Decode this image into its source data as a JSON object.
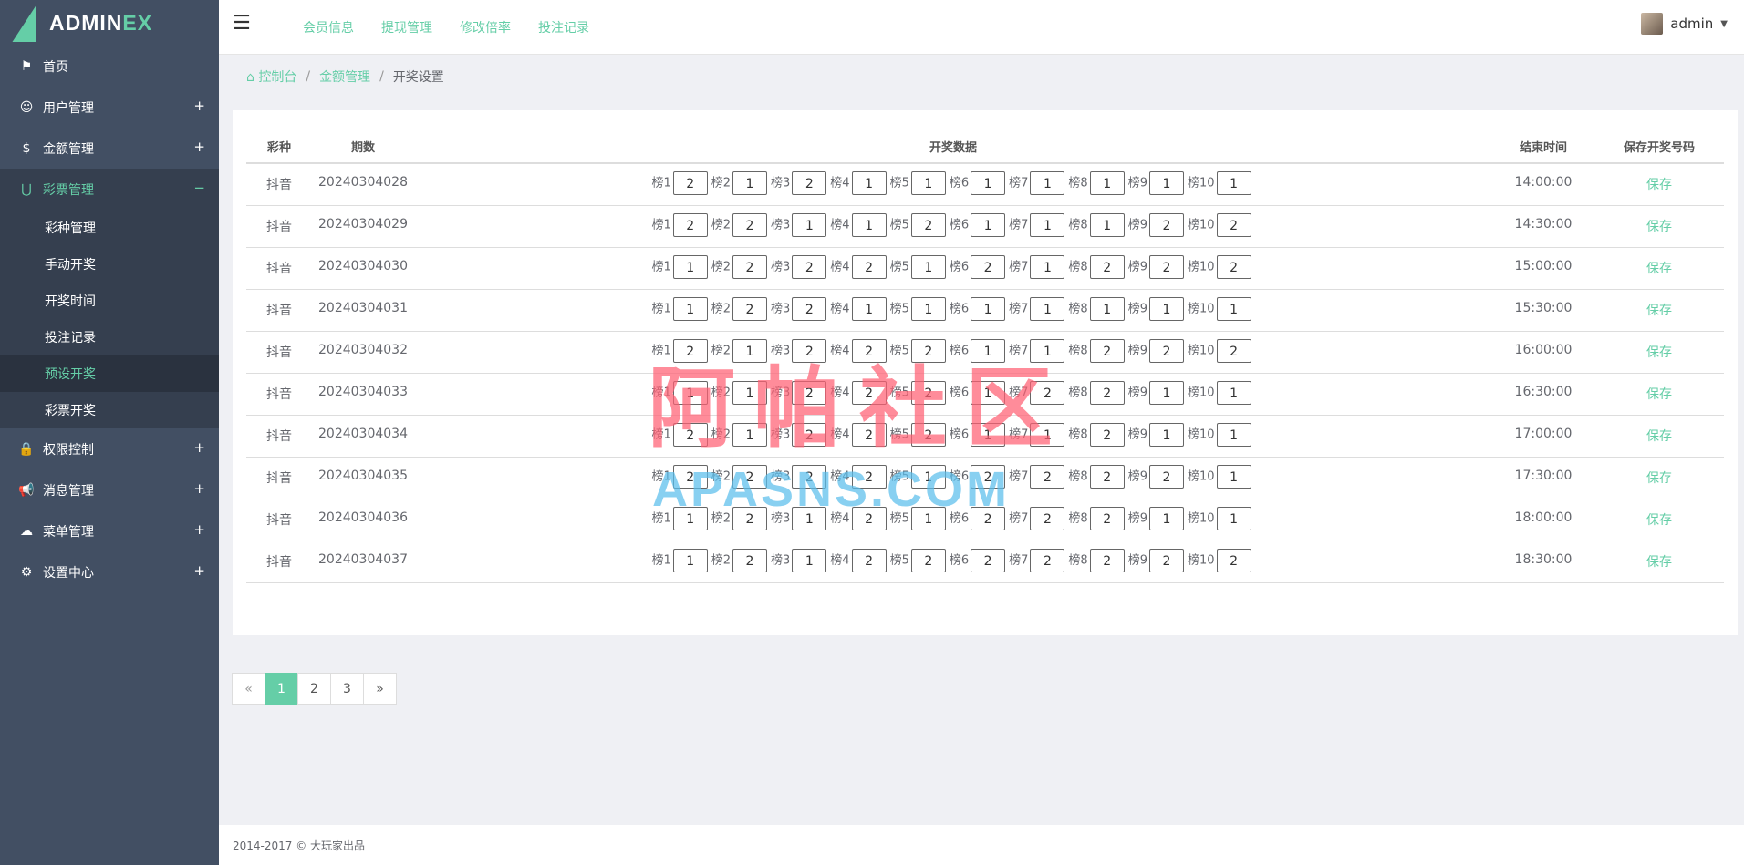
{
  "brand": {
    "name_main": "ADMIN",
    "name_accent": "EX"
  },
  "colors": {
    "accent": "#65cea7",
    "sidebar": "#424f63",
    "sidebar_active": "#353f4f"
  },
  "sidebar": {
    "items": [
      {
        "label": "首页",
        "icon": "flag-icon",
        "toggle": ""
      },
      {
        "label": "用户管理",
        "icon": "user-face-icon",
        "toggle": "+"
      },
      {
        "label": "金额管理",
        "icon": "dollar-icon",
        "toggle": "+"
      },
      {
        "label": "彩票管理",
        "icon": "magnet-icon",
        "toggle": "−",
        "children": [
          "彩种管理",
          "手动开奖",
          "开奖时间",
          "投注记录",
          "预设开奖",
          "彩票开奖"
        ],
        "active_child": "预设开奖"
      },
      {
        "label": "权限控制",
        "icon": "lock-icon",
        "toggle": "+"
      },
      {
        "label": "消息管理",
        "icon": "bullhorn-icon",
        "toggle": "+"
      },
      {
        "label": "菜单管理",
        "icon": "cloud-icon",
        "toggle": "+"
      },
      {
        "label": "设置中心",
        "icon": "gear-icon",
        "toggle": "+"
      }
    ]
  },
  "header": {
    "nav": [
      "会员信息",
      "提现管理",
      "修改倍率",
      "投注记录"
    ],
    "user": "admin"
  },
  "breadcrumb": {
    "home": "控制台",
    "parent": "金额管理",
    "current": "开奖设置"
  },
  "table": {
    "headers": [
      "彩种",
      "期数",
      "开奖数据",
      "结束时间",
      "保存开奖号码"
    ],
    "slot_labels": [
      "榜1",
      "榜2",
      "榜3",
      "榜4",
      "榜5",
      "榜6",
      "榜7",
      "榜8",
      "榜9",
      "榜10"
    ],
    "save_label": "保存",
    "rows": [
      {
        "type": "抖音",
        "period": "20240304028",
        "values": [
          "2",
          "1",
          "2",
          "1",
          "1",
          "1",
          "1",
          "1",
          "1",
          "1"
        ],
        "end": "14:00:00"
      },
      {
        "type": "抖音",
        "period": "20240304029",
        "values": [
          "2",
          "2",
          "1",
          "1",
          "2",
          "1",
          "1",
          "1",
          "2",
          "2"
        ],
        "end": "14:30:00"
      },
      {
        "type": "抖音",
        "period": "20240304030",
        "values": [
          "1",
          "2",
          "2",
          "2",
          "1",
          "2",
          "1",
          "2",
          "2",
          "2"
        ],
        "end": "15:00:00"
      },
      {
        "type": "抖音",
        "period": "20240304031",
        "values": [
          "1",
          "2",
          "2",
          "1",
          "1",
          "1",
          "1",
          "1",
          "1",
          "1"
        ],
        "end": "15:30:00"
      },
      {
        "type": "抖音",
        "period": "20240304032",
        "values": [
          "2",
          "1",
          "2",
          "2",
          "2",
          "1",
          "1",
          "2",
          "2",
          "2"
        ],
        "end": "16:00:00"
      },
      {
        "type": "抖音",
        "period": "20240304033",
        "values": [
          "1",
          "1",
          "2",
          "2",
          "2",
          "1",
          "2",
          "2",
          "1",
          "1"
        ],
        "end": "16:30:00"
      },
      {
        "type": "抖音",
        "period": "20240304034",
        "values": [
          "2",
          "1",
          "2",
          "2",
          "2",
          "1",
          "1",
          "2",
          "1",
          "1"
        ],
        "end": "17:00:00"
      },
      {
        "type": "抖音",
        "period": "20240304035",
        "values": [
          "2",
          "2",
          "2",
          "2",
          "1",
          "2",
          "2",
          "2",
          "2",
          "1"
        ],
        "end": "17:30:00"
      },
      {
        "type": "抖音",
        "period": "20240304036",
        "values": [
          "1",
          "2",
          "1",
          "2",
          "1",
          "2",
          "2",
          "2",
          "1",
          "1"
        ],
        "end": "18:00:00"
      },
      {
        "type": "抖音",
        "period": "20240304037",
        "values": [
          "1",
          "2",
          "1",
          "2",
          "2",
          "2",
          "2",
          "2",
          "2",
          "2"
        ],
        "end": "18:30:00"
      }
    ]
  },
  "watermark": {
    "cn": "阿帕社区",
    "en": "APASNS.COM"
  },
  "pagination": {
    "prev": "«",
    "pages": [
      "1",
      "2",
      "3"
    ],
    "current": "1",
    "next": "»"
  },
  "footer": {
    "text": "2014-2017 © 大玩家出品"
  }
}
